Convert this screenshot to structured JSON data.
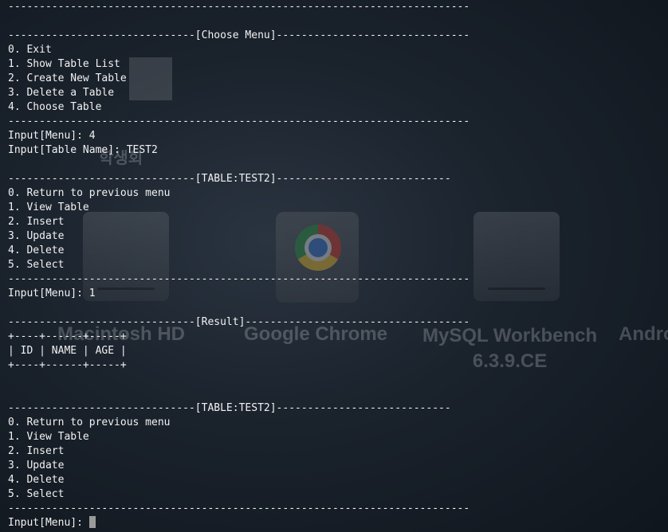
{
  "desktop": {
    "icons": [
      {
        "name": "Macintosh HD",
        "icon": "hard-drive-icon"
      },
      {
        "name": "Google Chrome",
        "icon": "chrome-icon"
      },
      {
        "name": "MySQL Workbench\n6.3.9.CE",
        "icon": "drive-icon"
      },
      {
        "name": "Andro",
        "icon": "drive-icon"
      }
    ],
    "korean_label": "학생회"
  },
  "terminal": {
    "lines": [
      "--------------------------------------------------------------------------",
      "",
      "------------------------------[Choose Menu]-------------------------------",
      "0. Exit",
      "1. Show Table List",
      "2. Create New Table",
      "3. Delete a Table",
      "4. Choose Table",
      "--------------------------------------------------------------------------",
      "Input[Menu]: 4",
      "Input[Table Name]: TEST2",
      "",
      "------------------------------[TABLE:TEST2]----------------------------",
      "0. Return to previous menu",
      "1. View Table",
      "2. Insert",
      "3. Update",
      "4. Delete",
      "5. Select",
      "--------------------------------------------------------------------------",
      "Input[Menu]: 1",
      "",
      "------------------------------[Result]------------------------------------",
      "+----+------+-----+",
      "| ID | NAME | AGE |",
      "+----+------+-----+",
      "",
      "",
      "------------------------------[TABLE:TEST2]----------------------------",
      "0. Return to previous menu",
      "1. View Table",
      "2. Insert",
      "3. Update",
      "4. Delete",
      "5. Select",
      "--------------------------------------------------------------------------"
    ],
    "prompt": "Input[Menu]: "
  }
}
